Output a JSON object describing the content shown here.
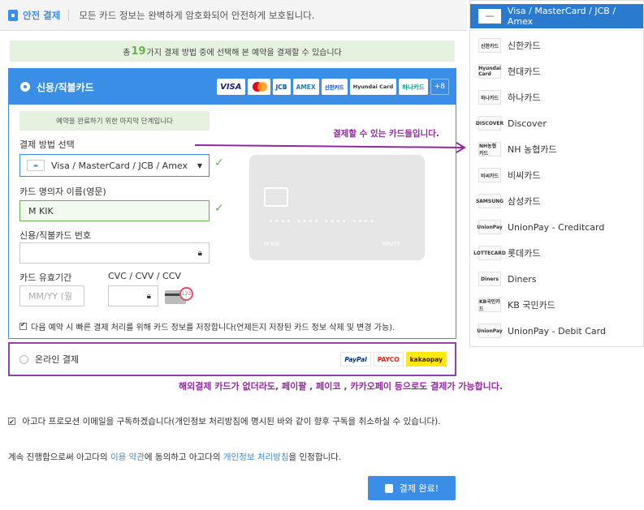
{
  "secure_bar": {
    "title": "안전 결제",
    "text": "모든 카드 정보는 완벽하게 암호화되어 안전하게 보호됩니다."
  },
  "banner": {
    "pre": "총",
    "count": "19",
    "post": "가지 결제 방법 중에 선택해 본 예약을 결제할 수 있습니다"
  },
  "credit": {
    "label": "신용/직불카드",
    "logos": [
      "VISA",
      "MC",
      "JCB",
      "AMEX",
      "신한카드",
      "Hyundai Card",
      "하나카드"
    ],
    "more": "+8"
  },
  "hint": "예약을 완료하기 위한 마지막 단계입니다",
  "annotation": "결제할 수 있는 카드들입니다.",
  "form": {
    "method_label": "결제 방법 선택",
    "method_value": "Visa / MasterCard / JCB / Amex",
    "name_label": "카드 명의자 이름(영문)",
    "name_value": "M KIK",
    "number_label": "신용/직불카드 번호",
    "expiry_label": "카드 유효기간",
    "expiry_placeholder": "MM/YY (월",
    "cvc_label": "CVC / CVV / CCV",
    "cvc_badge": "123",
    "save_text": "다음 예약 시 빠른 결제 처리를 위해 카드 정보를 저장합니다(언제든지 저장된 카드 정보 삭제 및 변경 가능)."
  },
  "card_preview": {
    "number": "•••• •••• •••• ••••",
    "name": "M KIK",
    "expiry": "MM/YY"
  },
  "online": {
    "label": "온라인 결제",
    "logos": [
      "PayPal",
      "PAYCO",
      "kakaopay"
    ]
  },
  "online_note": "해외결제 카드가 없더라도, 페이팔 , 페이코 , 카카오페이 등으로도 결제가 가능합니다.",
  "promo": "아고다 프로모션 이메일을 구독하겠습니다(개인정보 처리방침에 명시된 바와 같이 향후 구독을 취소하실 수 있습니다).",
  "terms": {
    "pre": "계속 진행함으로써 아고다의 ",
    "link1": "이용 약관",
    "mid": "에 동의하고 아고다의 ",
    "link2": "개인정보 처리방침",
    "post": "을 인정합니다."
  },
  "submit": "결제 완료!",
  "card_list": [
    {
      "icon": "----",
      "label": "Visa / MasterCard / JCB / Amex"
    },
    {
      "icon": "신한카드",
      "label": "신한카드"
    },
    {
      "icon": "Hyundai Card",
      "label": "현대카드"
    },
    {
      "icon": "하나카드",
      "label": "하나카드"
    },
    {
      "icon": "DISCOVER",
      "label": "Discover"
    },
    {
      "icon": "NH농협카드",
      "label": "NH 농협카드"
    },
    {
      "icon": "비씨카드",
      "label": "비씨카드"
    },
    {
      "icon": "SAMSUNG",
      "label": "삼성카드"
    },
    {
      "icon": "UnionPay",
      "label": "UnionPay - Creditcard"
    },
    {
      "icon": "LOTTECARD",
      "label": "롯데카드"
    },
    {
      "icon": "Diners",
      "label": "Diners"
    },
    {
      "icon": "KB국민카드",
      "label": "KB 국민카드"
    },
    {
      "icon": "UnionPay",
      "label": "UnionPay - Debit Card"
    }
  ],
  "colors": {
    "accent": "#3a8ee6",
    "annotation": "#8e2a9c",
    "ok": "#6ab04c"
  }
}
